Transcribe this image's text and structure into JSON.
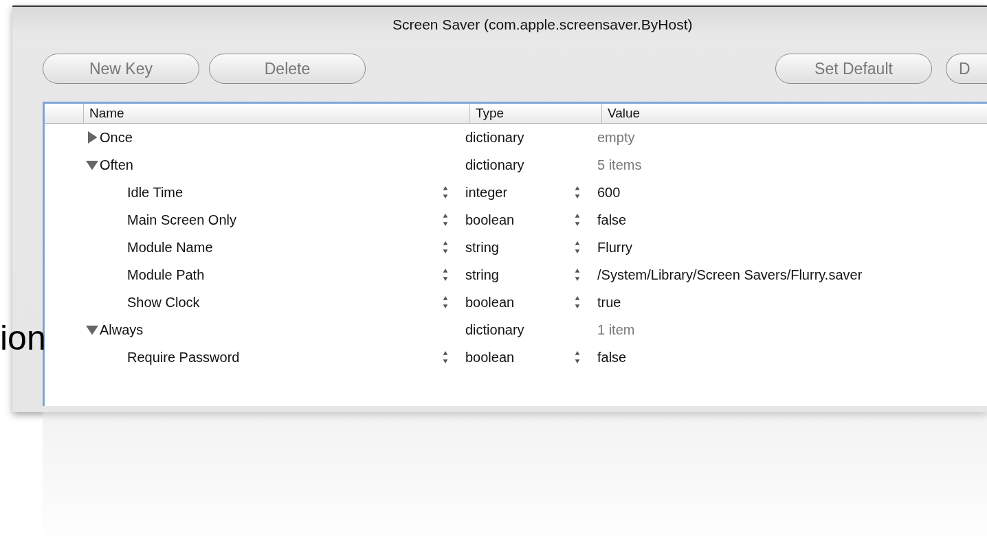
{
  "window": {
    "title": "Screen Saver (com.apple.screensaver.ByHost)"
  },
  "background_text": "ion",
  "toolbar": {
    "left_buttons": [
      "New Key",
      "Delete"
    ],
    "right_buttons": [
      "Set Default",
      "D"
    ]
  },
  "table": {
    "columns": [
      "Name",
      "Type",
      "Value"
    ],
    "rows": [
      {
        "name": "Once",
        "type": "dictionary",
        "value": "empty",
        "expanded": false,
        "children": []
      },
      {
        "name": "Often",
        "type": "dictionary",
        "value": "5 items",
        "expanded": true,
        "children": [
          {
            "name": "Idle Time",
            "type": "integer",
            "value": "600"
          },
          {
            "name": "Main Screen Only",
            "type": "boolean",
            "value": "false"
          },
          {
            "name": "Module Name",
            "type": "string",
            "value": "Flurry"
          },
          {
            "name": "Module Path",
            "type": "string",
            "value": "/System/Library/Screen Savers/Flurry.saver"
          },
          {
            "name": "Show Clock",
            "type": "boolean",
            "value": "true"
          }
        ]
      },
      {
        "name": "Always",
        "type": "dictionary",
        "value": "1 item",
        "expanded": true,
        "children": [
          {
            "name": "Require Password",
            "type": "boolean",
            "value": "false"
          }
        ]
      }
    ]
  }
}
